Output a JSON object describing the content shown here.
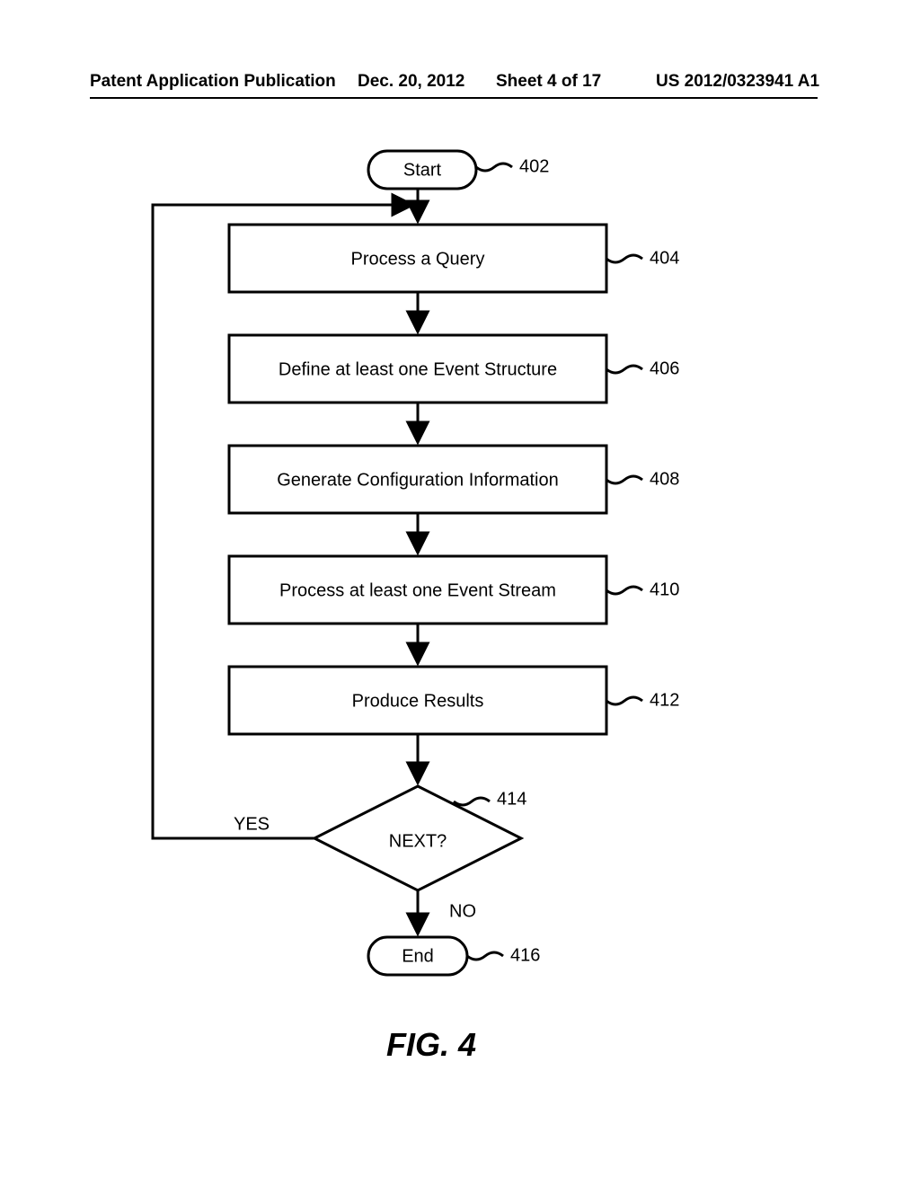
{
  "header": {
    "publication": "Patent Application Publication",
    "date": "Dec. 20, 2012",
    "sheet": "Sheet 4 of 17",
    "number": "US 2012/0323941 A1"
  },
  "flowchart": {
    "start": "Start",
    "step404": "Process a Query",
    "step406": "Define at least one Event Structure",
    "step408": "Generate Configuration Information",
    "step410": "Process at least one Event Stream",
    "step412": "Produce Results",
    "decision": "NEXT?",
    "end": "End",
    "yes": "YES",
    "no": "NO"
  },
  "refs": {
    "r402": "402",
    "r404": "404",
    "r406": "406",
    "r408": "408",
    "r410": "410",
    "r412": "412",
    "r414": "414",
    "r416": "416"
  },
  "figure_label": "FIG. 4"
}
